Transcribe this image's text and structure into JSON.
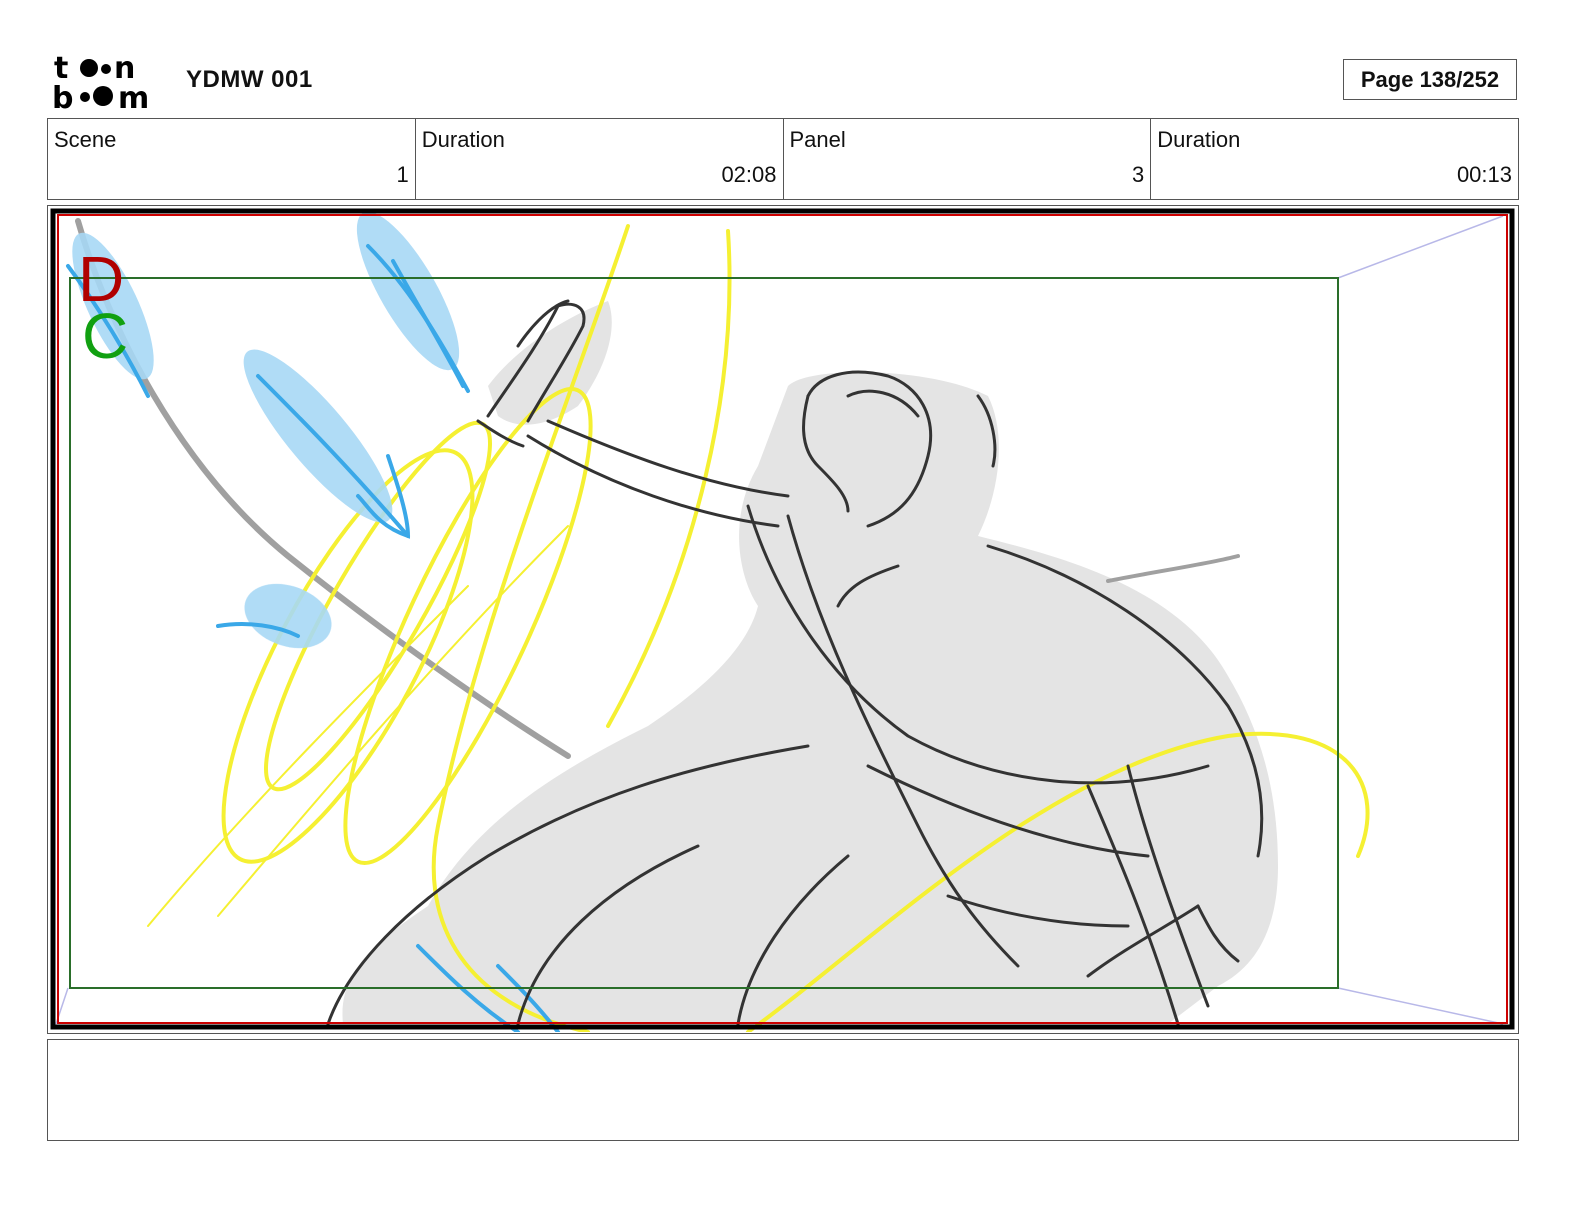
{
  "header": {
    "logo_name": "toon boom",
    "project_title": "YDMW 001",
    "page_label": "Page 138/252"
  },
  "info": {
    "scene_label": "Scene",
    "scene_value": "1",
    "scene_duration_label": "Duration",
    "scene_duration_value": "02:08",
    "panel_label": "Panel",
    "panel_value": "3",
    "panel_duration_label": "Duration",
    "panel_duration_value": "00:13"
  },
  "panel": {
    "marker_d": "D",
    "marker_c": "C",
    "colors": {
      "frame_black": "#000000",
      "frame_red": "#cc0000",
      "camera_green": "#2a6e2a",
      "marker_d": "#b00000",
      "marker_c": "#11a011",
      "effect_yellow": "#f5f032",
      "effect_blue": "#3aa8e8",
      "effect_blue_light": "#a8d8f5",
      "fill_gray": "#e4e4e4",
      "line_dark": "#333333"
    }
  },
  "notes": {
    "text": ""
  }
}
